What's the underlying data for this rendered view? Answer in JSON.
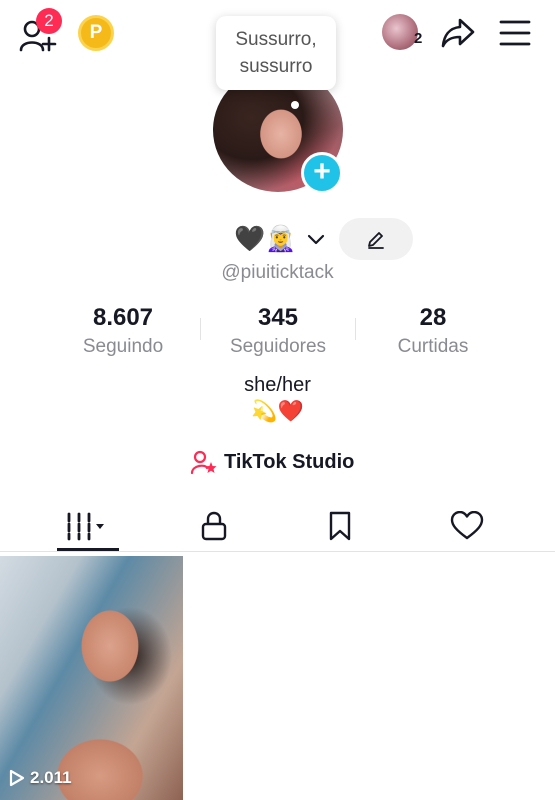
{
  "header": {
    "friend_requests_badge": "2",
    "coin_label": "P",
    "friends_count": "2"
  },
  "tooltip": {
    "text": "Sussurro, sussurro"
  },
  "profile": {
    "name_emoji": "🖤🧝‍♀️",
    "username": "@piuiticktack",
    "bio": "she/her",
    "bio_emoji": "💫❤️"
  },
  "stats": [
    {
      "value": "8.607",
      "label": "Seguindo"
    },
    {
      "value": "345",
      "label": "Seguidores"
    },
    {
      "value": "28",
      "label": "Curtidas"
    }
  ],
  "studio": {
    "label": "TikTok Studio"
  },
  "tabs": [
    {
      "name": "videos",
      "active": true
    },
    {
      "name": "private",
      "active": false
    },
    {
      "name": "favorites",
      "active": false
    },
    {
      "name": "liked",
      "active": false
    }
  ],
  "videos": [
    {
      "views": "2.011"
    }
  ],
  "colors": {
    "accent": "#fe2c55",
    "add_button": "#20c3e7",
    "coin": "#f6b91a",
    "text_secondary": "#8a8b91"
  }
}
